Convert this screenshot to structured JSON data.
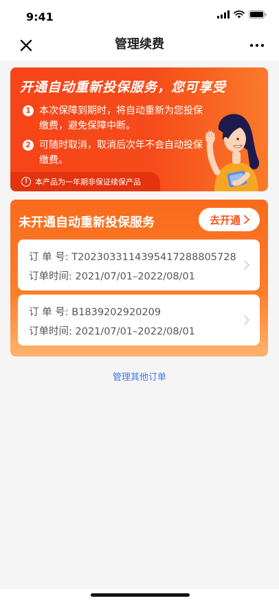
{
  "status_bar": {
    "time": "9:41"
  },
  "nav": {
    "title": "管理续费",
    "close_icon": "close-icon",
    "more_icon": "more-icon"
  },
  "banner": {
    "headline": "开通自动重新投保服务，您可享受",
    "points": [
      {
        "number": "1",
        "text": "本次保障到期时，将自动重新为您投保缴费，避免保障中断。"
      },
      {
        "number": "2",
        "text": "可随时取消，取消后次年不会自动投保缴费。"
      }
    ],
    "disclaimer": "本产品为一年期非保证续保产品",
    "colors": {
      "accent": "#f64b1a"
    }
  },
  "orders": {
    "title": "未开通自动重新投保服务",
    "activate_label": "去开通",
    "order_no_label": "订  单  号:",
    "order_time_label": "订单时间:",
    "items": [
      {
        "order_no": "T20230331143954172888057​28",
        "order_time": "2021/07/01–2022/08/01"
      },
      {
        "order_no": "B1839202920209",
        "order_time": "2021/07/01–2022/08/01"
      }
    ]
  },
  "manage_other_label": "管理其他订单"
}
